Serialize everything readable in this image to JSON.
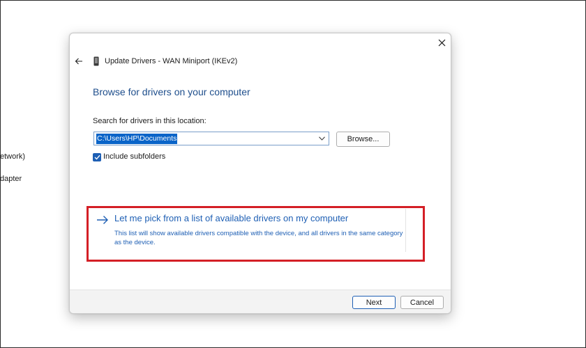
{
  "background": {
    "fragments": [
      "etwork)",
      "dapter"
    ]
  },
  "dialog": {
    "title": "Update Drivers - WAN Miniport (IKEv2)",
    "heading": "Browse for drivers on your computer",
    "search_label": "Search for drivers in this location:",
    "path_value": "C:\\Users\\HP\\Documents",
    "browse_label": "Browse...",
    "include_subfolders_label": "Include subfolders",
    "include_subfolders_checked": true,
    "pick_title": "Let me pick from a list of available drivers on my computer",
    "pick_description": "This list will show available drivers compatible with the device, and all drivers in the same category as the device.",
    "next_label": "Next",
    "cancel_label": "Cancel"
  },
  "icons": {
    "close": "close-icon",
    "back": "back-arrow-icon",
    "device": "device-icon",
    "dropdown": "chevron-down-icon",
    "check": "checkmark-icon",
    "link_arrow": "right-arrow-icon"
  },
  "colors": {
    "accent": "#1e5fb4",
    "heading": "#1e4e8c",
    "selection": "#0a64c8",
    "highlight_box": "#d41f26"
  }
}
